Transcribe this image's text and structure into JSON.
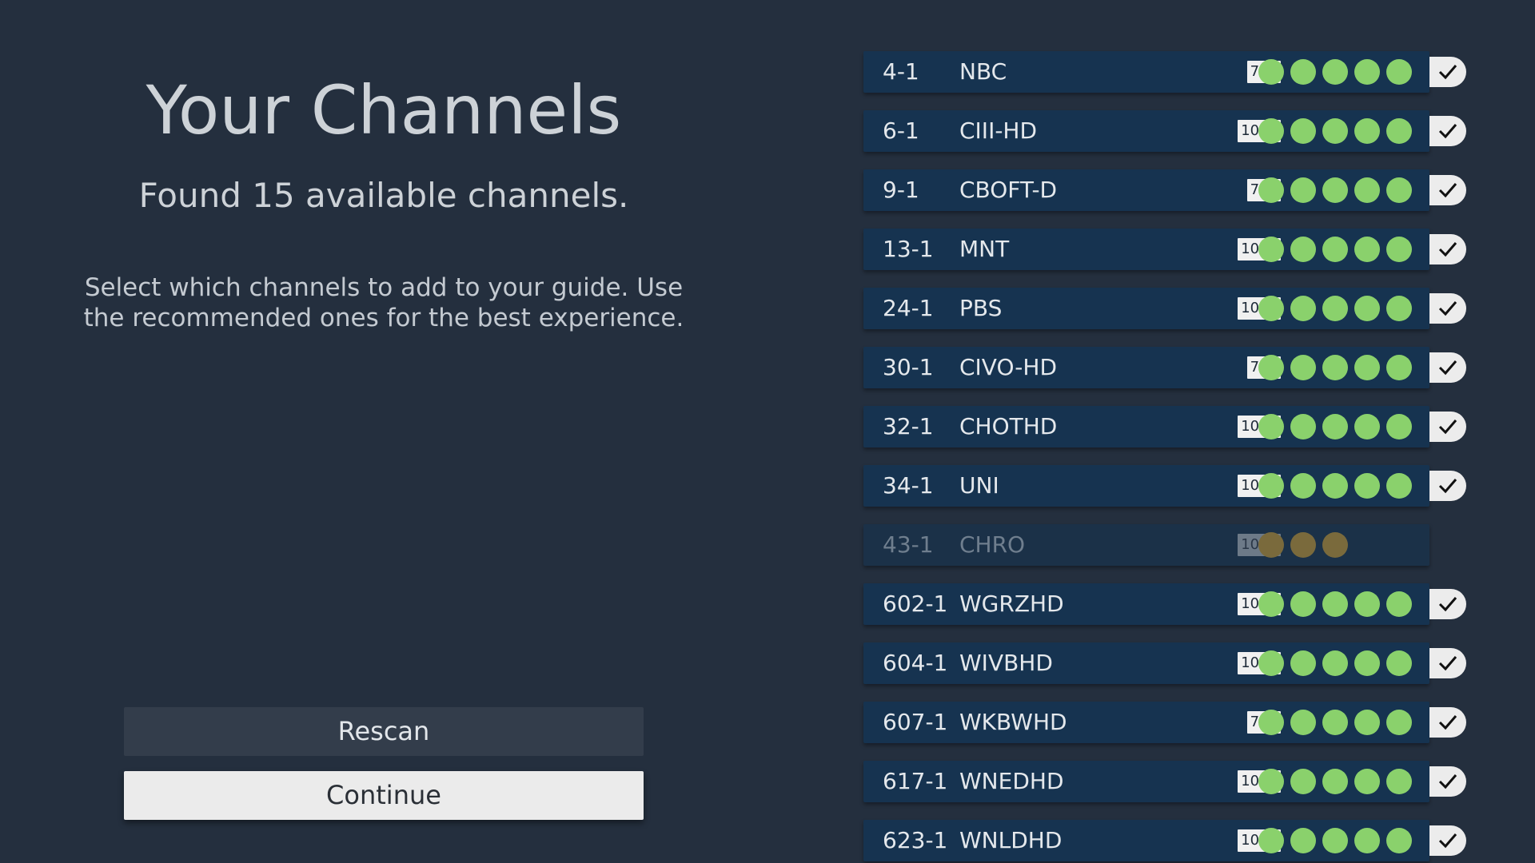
{
  "header": {
    "title": "Your Channels",
    "subtitle": "Found 15 available channels.",
    "description": "Select which channels to add to your guide. Use the recommended ones for the best experience."
  },
  "actions": {
    "rescan_label": "Rescan",
    "continue_label": "Continue"
  },
  "colors": {
    "background": "#242f3e",
    "row": "#163350",
    "signal_good": "#8ad16c",
    "signal_weak": "#7a6a3c"
  },
  "channels": [
    {
      "number": "4-1",
      "name": "NBC",
      "resolution": "720",
      "signal": 5,
      "selected": true,
      "disabled": false
    },
    {
      "number": "6-1",
      "name": "CIII-HD",
      "resolution": "1080",
      "signal": 5,
      "selected": true,
      "disabled": false
    },
    {
      "number": "9-1",
      "name": "CBOFT-D",
      "resolution": "720",
      "signal": 5,
      "selected": true,
      "disabled": false
    },
    {
      "number": "13-1",
      "name": "MNT",
      "resolution": "1080",
      "signal": 5,
      "selected": true,
      "disabled": false
    },
    {
      "number": "24-1",
      "name": "PBS",
      "resolution": "1080",
      "signal": 5,
      "selected": true,
      "disabled": false
    },
    {
      "number": "30-1",
      "name": "CIVO-HD",
      "resolution": "720",
      "signal": 5,
      "selected": true,
      "disabled": false
    },
    {
      "number": "32-1",
      "name": "CHOTHD",
      "resolution": "1080",
      "signal": 5,
      "selected": true,
      "disabled": false
    },
    {
      "number": "34-1",
      "name": "UNI",
      "resolution": "1080",
      "signal": 5,
      "selected": true,
      "disabled": false
    },
    {
      "number": "43-1",
      "name": "CHRO",
      "resolution": "1080",
      "signal": 3,
      "selected": false,
      "disabled": true
    },
    {
      "number": "602-1",
      "name": "WGRZHD",
      "resolution": "1080",
      "signal": 5,
      "selected": true,
      "disabled": false
    },
    {
      "number": "604-1",
      "name": "WIVBHD",
      "resolution": "1080",
      "signal": 5,
      "selected": true,
      "disabled": false
    },
    {
      "number": "607-1",
      "name": "WKBWHD",
      "resolution": "720",
      "signal": 5,
      "selected": true,
      "disabled": false
    },
    {
      "number": "617-1",
      "name": "WNEDHD",
      "resolution": "1080",
      "signal": 5,
      "selected": true,
      "disabled": false
    },
    {
      "number": "623-1",
      "name": "WNLDHD",
      "resolution": "1080",
      "signal": 5,
      "selected": true,
      "disabled": false
    }
  ]
}
